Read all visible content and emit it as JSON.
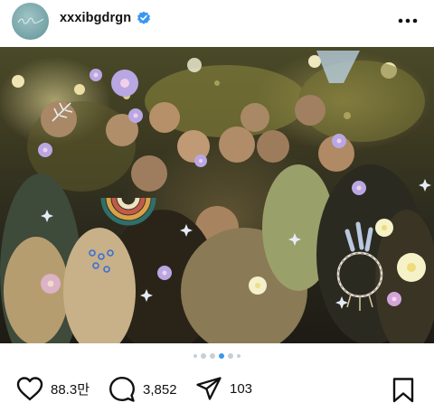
{
  "header": {
    "username": "xxxibgdrgn",
    "verified": true,
    "avatar_icon": "signature-avatar",
    "more_icon": "more-horizontal-icon"
  },
  "post": {
    "image_alt": "",
    "carousel": {
      "total": 6,
      "active_index": 3
    }
  },
  "actions": {
    "likes": "88.3만",
    "comments": "3,852",
    "shares": "103",
    "like_icon": "heart-icon",
    "comment_icon": "comment-icon",
    "share_icon": "paper-plane-icon",
    "save_icon": "bookmark-icon"
  },
  "colors": {
    "verified_blue": "#3897f0",
    "active_dot": "#3897f0",
    "inactive_dot": "#c9ced3",
    "text": "#111111"
  }
}
